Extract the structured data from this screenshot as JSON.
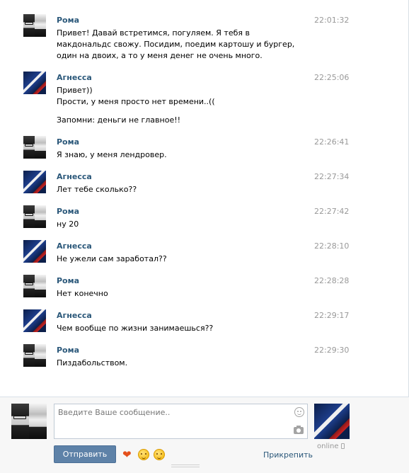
{
  "messages": [
    {
      "author": "Рома",
      "avatar": "roma",
      "time": "22:01:32",
      "paragraphs": [
        "Привет! Давай встретимся, погуляем. Я тебя в макдональдс свожу. Посидим, поедим картошу и бургер, один на двоих, а то у меня денег не очень много."
      ]
    },
    {
      "author": "Агнесса",
      "avatar": "agnessa",
      "time": "22:25:06",
      "paragraphs": [
        "Привет))\nПрости, у меня просто нет времени..((",
        "Запомни: деньги не главное!!"
      ]
    },
    {
      "author": "Рома",
      "avatar": "roma",
      "time": "22:26:41",
      "paragraphs": [
        "Я знаю, у меня лендровер."
      ]
    },
    {
      "author": "Агнесса",
      "avatar": "agnessa",
      "time": "22:27:34",
      "paragraphs": [
        "Лет тебе сколько??"
      ]
    },
    {
      "author": "Рома",
      "avatar": "roma",
      "time": "22:27:42",
      "paragraphs": [
        "ну 20"
      ]
    },
    {
      "author": "Агнесса",
      "avatar": "agnessa",
      "time": "22:28:10",
      "paragraphs": [
        "Не ужели сам заработал??"
      ]
    },
    {
      "author": "Рома",
      "avatar": "roma",
      "time": "22:28:28",
      "paragraphs": [
        "Нет конечно"
      ]
    },
    {
      "author": "Агнесса",
      "avatar": "agnessa",
      "time": "22:29:17",
      "paragraphs": [
        "Чем вообще по жизни занимаешься??"
      ]
    },
    {
      "author": "Рома",
      "avatar": "roma",
      "time": "22:29:30",
      "paragraphs": [
        "Пиздабольством."
      ]
    }
  ],
  "compose": {
    "placeholder": "Введите Ваше сообщение..",
    "send_label": "Отправить",
    "attach_label": "Прикрепить",
    "status": "online",
    "emoji": [
      "heart-icon",
      "smile-emoji",
      "relieved-emoji"
    ]
  },
  "colors": {
    "name_link": "#2b587a",
    "timestamp": "#999999",
    "send_button": "#5e82a8"
  }
}
